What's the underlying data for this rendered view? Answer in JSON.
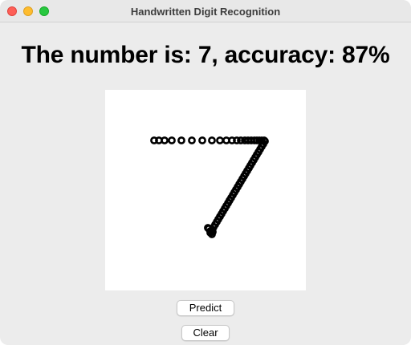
{
  "window": {
    "title": "Handwritten Digit Recognition"
  },
  "result": {
    "text": "The number is: 7, accuracy: 87%"
  },
  "buttons": {
    "predict_label": "Predict",
    "clear_label": "Clear"
  },
  "colors": {
    "window_bg": "#ececec",
    "canvas_bg": "#ffffff",
    "stroke": "#000000",
    "close": "#fe5f57",
    "minimize": "#febc2e",
    "maximize": "#28c840"
  }
}
